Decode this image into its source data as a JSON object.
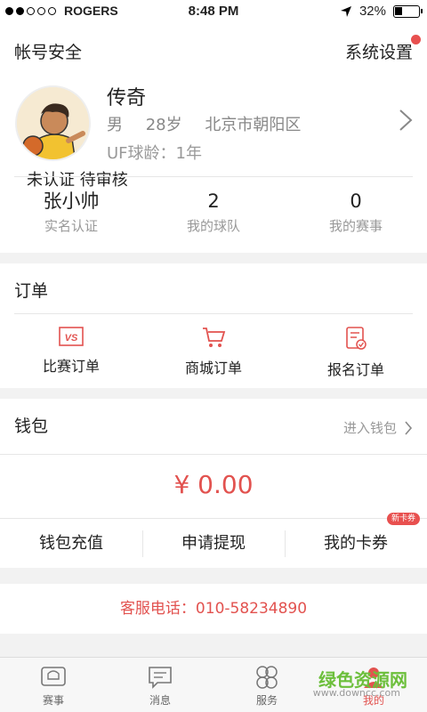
{
  "status_bar": {
    "carrier": "ROGERS",
    "time": "8:48 PM",
    "battery": "32%",
    "battery_level": 0.32
  },
  "header": {
    "account_security": "帐号安全",
    "system_settings": "系统设置"
  },
  "profile": {
    "name": "传奇",
    "gender": "男",
    "age": "28岁",
    "location": "北京市朝阳区",
    "uf_age": "UF球龄：1年",
    "cert_status": "未认证 待审核"
  },
  "stats": [
    {
      "value": "张小帅",
      "label": "实名认证"
    },
    {
      "value": "2",
      "label": "我的球队"
    },
    {
      "value": "0",
      "label": "我的赛事"
    }
  ],
  "orders": {
    "title": "订单",
    "items": [
      {
        "label": "比赛订单",
        "icon": "vs-ticket-icon"
      },
      {
        "label": "商城订单",
        "icon": "cart-icon"
      },
      {
        "label": "报名订单",
        "icon": "signup-form-icon"
      }
    ]
  },
  "wallet": {
    "title": "钱包",
    "enter_label": "进入钱包",
    "amount": "¥ 0.00",
    "buttons": [
      "钱包充值",
      "申请提现",
      "我的卡券"
    ],
    "new_badge": "新卡券"
  },
  "service": {
    "text": "客服电话：010-58234890"
  },
  "tabs": [
    {
      "label": "赛事",
      "icon": "match-icon",
      "active": false
    },
    {
      "label": "消息",
      "icon": "message-icon",
      "active": false
    },
    {
      "label": "服务",
      "icon": "service-icon",
      "active": false
    },
    {
      "label": "我的",
      "icon": "me-icon",
      "active": true
    }
  ],
  "watermark": {
    "text": "绿色资源网",
    "sub": "www.downcc.com"
  },
  "colors": {
    "accent": "#e2524f",
    "badge": "#e8504f"
  }
}
